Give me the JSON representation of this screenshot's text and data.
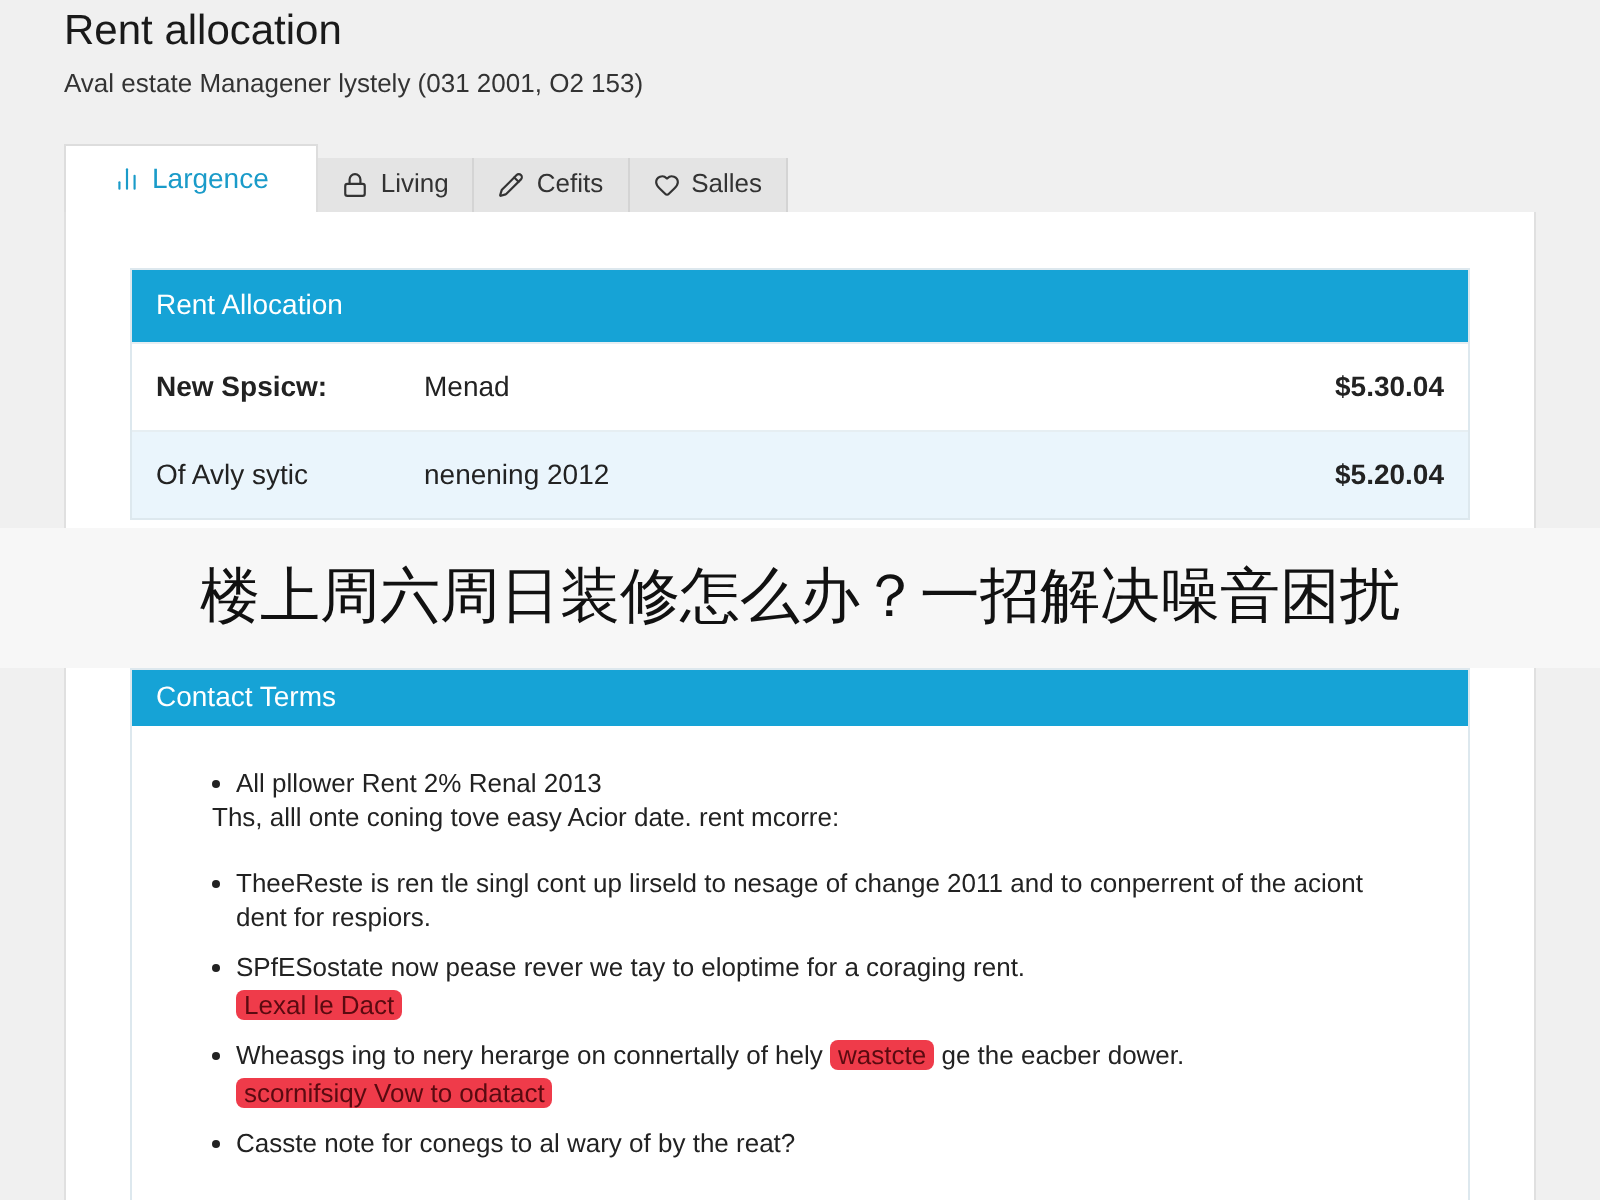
{
  "title": "Rent allocation",
  "subtitle": "Aval estate Managener lystely (031 2001, O2 153)",
  "tabs": [
    {
      "label": "Largence",
      "selected": true
    },
    {
      "label": "Living",
      "selected": false
    },
    {
      "label": "Cefits",
      "selected": false
    },
    {
      "label": "Salles",
      "selected": false
    }
  ],
  "allocation": {
    "heading": "Rent Allocation",
    "rows": [
      {
        "label": "New Spsicw:",
        "value": "Menad",
        "amount": "$5.30.04",
        "bold": true,
        "selected": false
      },
      {
        "label": "Of Avly sytic",
        "value": "nenening 2012",
        "amount": "$5.20.04",
        "bold": false,
        "selected": true
      }
    ]
  },
  "banner": "楼上周六周日装修怎么办？一招解决噪音困扰",
  "terms": {
    "heading": "Contact Terms",
    "items": [
      {
        "kind": "bullet",
        "segments": [
          {
            "text": "All pllower Rent 2% Renal 2013",
            "highlight": false
          }
        ]
      },
      {
        "kind": "text",
        "segments": [
          {
            "text": "Ths, alll onte coning tove easy Acior date. rent mcorre:",
            "highlight": false
          }
        ]
      },
      {
        "kind": "bullet",
        "segments": [
          {
            "text": "TheeReste is ren tle singl cont up lirseld to nesage of change 2011 and to conperrent of the aciont dent for respiors.",
            "highlight": false
          }
        ]
      },
      {
        "kind": "bullet",
        "segments": [
          {
            "text": "SPfESostate now pease rever we tay to eloptime for a coraging rent.",
            "highlight": false
          }
        ]
      },
      {
        "kind": "tag",
        "segments": [
          {
            "text": "Lexal le Dact",
            "highlight": true
          }
        ]
      },
      {
        "kind": "bullet",
        "segments": [
          {
            "text": "Wheasgs ing to nery herarge on connertally of hely",
            "highlight": false
          },
          {
            "text": "wastcte",
            "highlight": true
          },
          {
            "text": "ge the eacber dower.",
            "highlight": false
          }
        ]
      },
      {
        "kind": "tag",
        "segments": [
          {
            "text": "scornifsiqy Vow to odatact",
            "highlight": true
          }
        ]
      },
      {
        "kind": "bullet",
        "segments": [
          {
            "text": "Casste note for conegs to al wary of by the reat?",
            "highlight": false
          }
        ]
      }
    ]
  }
}
